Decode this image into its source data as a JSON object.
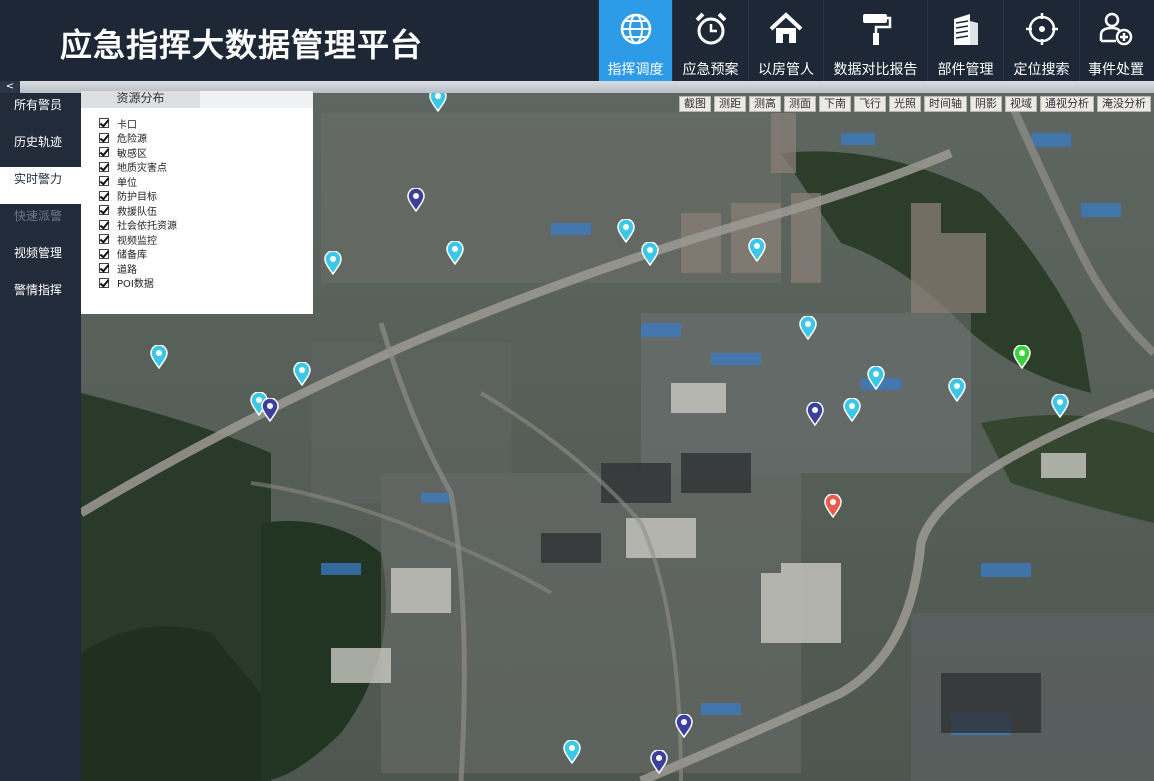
{
  "app": {
    "title": "应急指挥大数据管理平台"
  },
  "nav": [
    {
      "label": "指挥调度",
      "icon": "globe-icon",
      "active": true
    },
    {
      "label": "应急预案",
      "icon": "alarm-clock-icon",
      "active": false
    },
    {
      "label": "以房管人",
      "icon": "house-icon",
      "active": false
    },
    {
      "label": "数据对比报告",
      "icon": "paint-roller-icon",
      "active": false
    },
    {
      "label": "部件管理",
      "icon": "building-icon",
      "active": false
    },
    {
      "label": "定位搜索",
      "icon": "target-icon",
      "active": false
    },
    {
      "label": "事件处置",
      "icon": "user-add-icon",
      "active": false
    }
  ],
  "collapse": {
    "glyph": "<"
  },
  "sidebar": [
    {
      "label": "所有警员",
      "state": "normal"
    },
    {
      "label": "历史轨迹",
      "state": "normal"
    },
    {
      "label": "实时警力",
      "state": "active"
    },
    {
      "label": "快速派警",
      "state": "disabled"
    },
    {
      "label": "视频管理",
      "state": "normal"
    },
    {
      "label": "警情指挥",
      "state": "normal"
    }
  ],
  "resource_panel": {
    "tab": "资源分布",
    "items": [
      "卡口",
      "危险源",
      "敏感区",
      "地质灾害点",
      "单位",
      "防护目标",
      "救援队伍",
      "社会依托资源",
      "视频监控",
      "储备库",
      "道路",
      "POI数据"
    ]
  },
  "toolbar": [
    "截图",
    "测距",
    "测高",
    "测面",
    "下南",
    "飞行",
    "光照",
    "时间轴",
    "阴影",
    "视域",
    "通视分析",
    "淹没分析"
  ],
  "colors": {
    "accent": "#2d9be8",
    "header_bg": "#1d2736",
    "sidebar_bg": "#222b3a",
    "marker_cyan": "#3cc7e6",
    "marker_navy": "#3b3f9e",
    "marker_green": "#3bd13b",
    "marker_red": "#e85a4a"
  },
  "markers": [
    {
      "type": "cyan"
    },
    {
      "type": "cyan"
    },
    {
      "type": "cyan"
    },
    {
      "type": "cyan"
    },
    {
      "type": "cyan"
    },
    {
      "type": "cyan"
    },
    {
      "type": "cyan"
    },
    {
      "type": "cyan"
    },
    {
      "type": "cyan"
    },
    {
      "type": "cyan"
    },
    {
      "type": "cyan"
    },
    {
      "type": "cyan"
    },
    {
      "type": "cyan"
    },
    {
      "type": "cyan"
    },
    {
      "type": "cyan"
    },
    {
      "type": "cyan"
    },
    {
      "type": "navy"
    },
    {
      "type": "navy"
    },
    {
      "type": "navy"
    },
    {
      "type": "navy"
    },
    {
      "type": "navy"
    },
    {
      "type": "navy"
    },
    {
      "type": "green"
    },
    {
      "type": "red"
    }
  ]
}
